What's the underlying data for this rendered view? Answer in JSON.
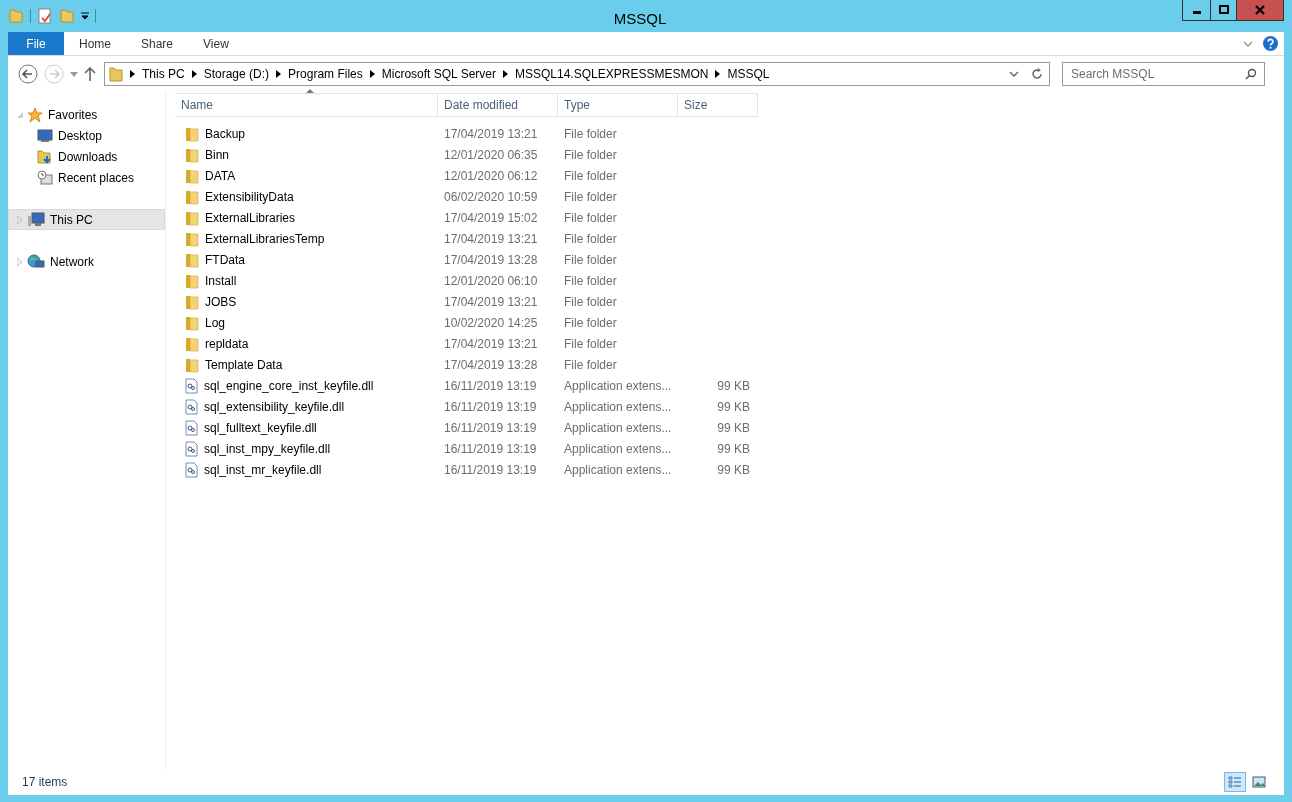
{
  "window": {
    "title": "MSSQL"
  },
  "ribbon": {
    "tabs": [
      {
        "label": "File",
        "selected": true
      },
      {
        "label": "Home",
        "selected": false
      },
      {
        "label": "Share",
        "selected": false
      },
      {
        "label": "View",
        "selected": false
      }
    ]
  },
  "address": {
    "segments": [
      "This PC",
      "Storage (D:)",
      "Program Files",
      "Microsoft SQL Server",
      "MSSQL14.SQLEXPRESSMESMON",
      "MSSQL"
    ]
  },
  "search": {
    "placeholder": "Search MSSQL"
  },
  "navigation": [
    {
      "label": "Favorites",
      "kind": "star",
      "expanded": true,
      "selected": false,
      "children": [
        {
          "label": "Desktop",
          "kind": "desktop",
          "selected": false
        },
        {
          "label": "Downloads",
          "kind": "downloads",
          "selected": false
        },
        {
          "label": "Recent places",
          "kind": "recent",
          "selected": false
        }
      ]
    },
    {
      "label": "This PC",
      "kind": "pc",
      "expanded": false,
      "selected": true
    },
    {
      "label": "Network",
      "kind": "network",
      "expanded": false,
      "selected": false
    }
  ],
  "table": {
    "columns": [
      {
        "label": "Name",
        "sorted": true
      },
      {
        "label": "Date modified",
        "sorted": false
      },
      {
        "label": "Type",
        "sorted": false
      },
      {
        "label": "Size",
        "sorted": false
      }
    ],
    "rows": [
      {
        "kind": "folder",
        "name": "Backup",
        "date": "17/04/2019 13:21",
        "type": "File folder"
      },
      {
        "kind": "folder",
        "name": "Binn",
        "date": "12/01/2020 06:35",
        "type": "File folder"
      },
      {
        "kind": "folder",
        "name": "DATA",
        "date": "12/01/2020 06:12",
        "type": "File folder"
      },
      {
        "kind": "folder",
        "name": "ExtensibilityData",
        "date": "06/02/2020 10:59",
        "type": "File folder"
      },
      {
        "kind": "folder",
        "name": "ExternalLibraries",
        "date": "17/04/2019 15:02",
        "type": "File folder"
      },
      {
        "kind": "folder",
        "name": "ExternalLibrariesTemp",
        "date": "17/04/2019 13:21",
        "type": "File folder"
      },
      {
        "kind": "folder",
        "name": "FTData",
        "date": "17/04/2019 13:28",
        "type": "File folder"
      },
      {
        "kind": "folder",
        "name": "Install",
        "date": "12/01/2020 06:10",
        "type": "File folder"
      },
      {
        "kind": "folder",
        "name": "JOBS",
        "date": "17/04/2019 13:21",
        "type": "File folder"
      },
      {
        "kind": "folder",
        "name": "Log",
        "date": "10/02/2020 14:25",
        "type": "File folder"
      },
      {
        "kind": "folder",
        "name": "repldata",
        "date": "17/04/2019 13:21",
        "type": "File folder"
      },
      {
        "kind": "folder",
        "name": "Template Data",
        "date": "17/04/2019 13:28",
        "type": "File folder"
      },
      {
        "kind": "file",
        "name": "sql_engine_core_inst_keyfile.dll",
        "date": "16/11/2019 13:19",
        "type": "Application extens...",
        "size": "99 KB"
      },
      {
        "kind": "file",
        "name": "sql_extensibility_keyfile.dll",
        "date": "16/11/2019 13:19",
        "type": "Application extens...",
        "size": "99 KB"
      },
      {
        "kind": "file",
        "name": "sql_fulltext_keyfile.dll",
        "date": "16/11/2019 13:19",
        "type": "Application extens...",
        "size": "99 KB"
      },
      {
        "kind": "file",
        "name": "sql_inst_mpy_keyfile.dll",
        "date": "16/11/2019 13:19",
        "type": "Application extens...",
        "size": "99 KB"
      },
      {
        "kind": "file",
        "name": "sql_inst_mr_keyfile.dll",
        "date": "16/11/2019 13:19",
        "type": "Application extens...",
        "size": "99 KB"
      }
    ]
  },
  "status_bar": {
    "item_count": "17 items",
    "views": [
      {
        "kind": "details",
        "selected": true
      },
      {
        "kind": "large",
        "selected": false
      }
    ]
  }
}
